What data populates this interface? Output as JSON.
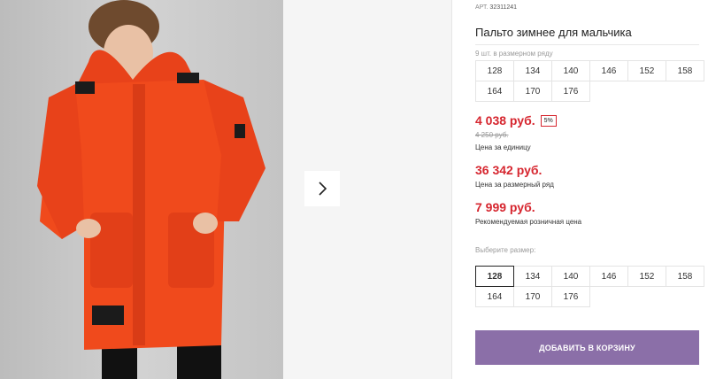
{
  "gallery": {
    "photo_alt": "boy-orange-winter-coat-photo",
    "next_icon": "chevron-right-icon"
  },
  "product": {
    "article_label": "АРТ.",
    "article_value": "32311241",
    "title": "Пальто зимнее для мальчика",
    "row_label": "9 шт. в размерном ряду",
    "row_sizes": [
      "128",
      "134",
      "140",
      "146",
      "152",
      "158",
      "164",
      "170",
      "176"
    ],
    "price_unit": "4 038 руб.",
    "discount_badge": "5%",
    "old_price": "4 250 руб.",
    "price_unit_note": "Цена за единицу",
    "price_row": "36 342 руб.",
    "price_row_note": "Цена за размерный ряд",
    "price_retail": "7 999 руб.",
    "price_retail_note": "Рекомендуемая розничная цена",
    "choose_size_label": "Выберите размер:",
    "choose_sizes": [
      "128",
      "134",
      "140",
      "146",
      "152",
      "158",
      "164",
      "170",
      "176"
    ],
    "selected_size": "128",
    "cart_button": "ДОБАВИТЬ В КОРЗИНУ"
  },
  "colors": {
    "price": "#d6262f",
    "cart_button": "#8b6fa8",
    "coat": "#f04a1c"
  }
}
